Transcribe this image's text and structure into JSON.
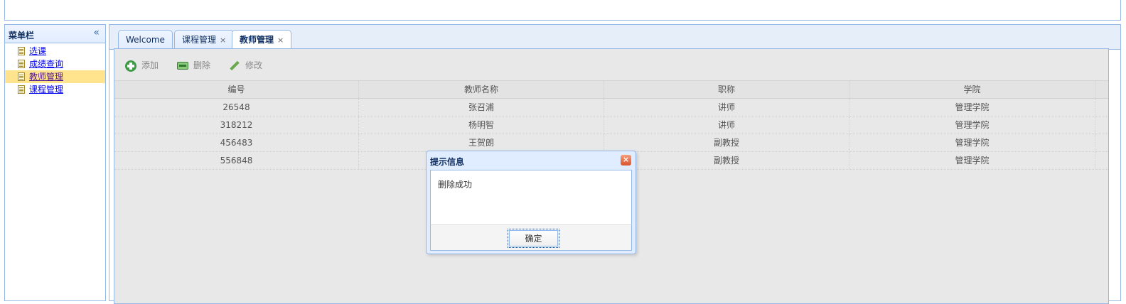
{
  "menu": {
    "title": "菜单栏",
    "collapse_icon": "double-chevron-left-icon",
    "items": [
      {
        "label": "选课",
        "icon": "document-icon"
      },
      {
        "label": "成绩查询",
        "icon": "document-icon"
      },
      {
        "label": "教师管理",
        "icon": "document-icon",
        "selected": true
      },
      {
        "label": "课程管理",
        "icon": "document-icon"
      }
    ]
  },
  "tabs": [
    {
      "label": "Welcome",
      "closable": false
    },
    {
      "label": "课程管理",
      "closable": true,
      "close_glyph": "×"
    },
    {
      "label": "教师管理",
      "closable": true,
      "close_glyph": "×",
      "active": true
    }
  ],
  "toolbar": {
    "add_label": "添加",
    "delete_label": "删除",
    "edit_label": "修改"
  },
  "table": {
    "columns": [
      "编号",
      "教师名称",
      "职称",
      "学院"
    ],
    "rows": [
      [
        "26548",
        "张召浦",
        "讲师",
        "管理学院"
      ],
      [
        "318212",
        "杨明智",
        "讲师",
        "管理学院"
      ],
      [
        "456483",
        "王贺朗",
        "副教授",
        "管理学院"
      ],
      [
        "556848",
        "",
        "副教授",
        "管理学院"
      ]
    ]
  },
  "dialog": {
    "title": "提示信息",
    "close_glyph": "×",
    "message": "删除成功",
    "ok_label": "确定"
  },
  "colors": {
    "border": "#95b8e7",
    "header_bg": "#e0ecff",
    "selected_row": "#ffe48d",
    "content_bg": "#e8e8e8"
  }
}
